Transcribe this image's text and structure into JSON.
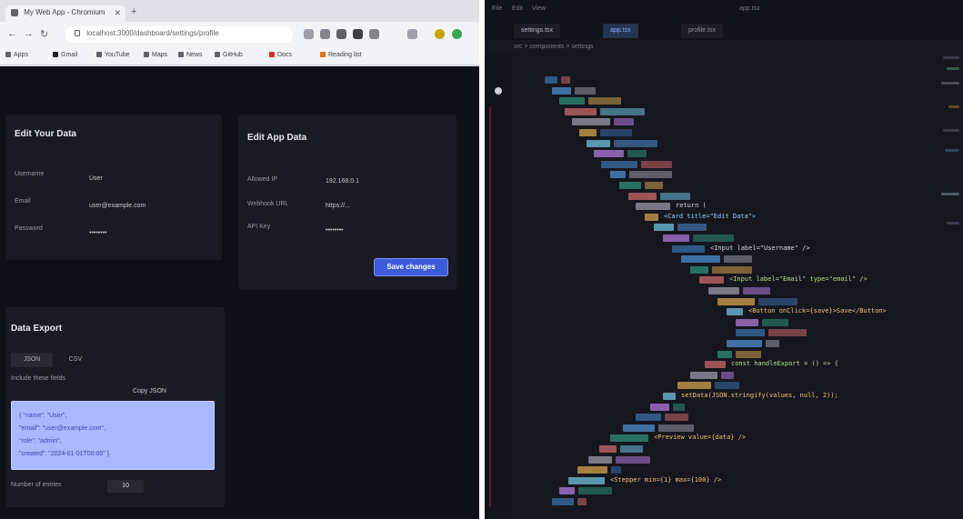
{
  "browser": {
    "tab_title": "My Web App - Chromium",
    "address": "localhost:3000/dashboard/settings/profile",
    "bookmarks": [
      "Apps",
      "Gmail",
      "YouTube",
      "Maps",
      "News",
      "GitHub",
      "Docs",
      "Reading list"
    ]
  },
  "page": {
    "edit_profile_card": {
      "title": "Edit Your Data",
      "rows": [
        {
          "label": "Username",
          "value": "User"
        },
        {
          "label": "Email",
          "value": "user@example.com"
        },
        {
          "label": "Password",
          "value": "••••••••"
        }
      ]
    },
    "edit_app_card": {
      "title": "Edit App Data",
      "rows": [
        {
          "label": "Allowed IP",
          "value": "192.168.0.1"
        },
        {
          "label": "Webhook URL",
          "value": "https://..."
        },
        {
          "label": "API Key",
          "value": "••••••••"
        }
      ],
      "save_label": "Save changes"
    },
    "export_card": {
      "title": "Data Export",
      "segments": [
        "JSON",
        "CSV"
      ],
      "caption": "Include these fields",
      "side_button": "Copy JSON",
      "preview_lines": [
        "{ \"name\": \"User\",",
        "  \"email\": \"user@example.com\",",
        "  \"role\": \"admin\",",
        "  \"created\": \"2024-01-01T00:00\" }"
      ],
      "stepper_label": "Number of entries",
      "stepper_value": "10"
    }
  },
  "editor": {
    "title_items": [
      "File",
      "Edit",
      "View"
    ],
    "window_title": "app.tsx",
    "tabs": [
      "settings.tsx",
      "app.tsx",
      "profile.tsx"
    ],
    "breadcrumb": "src > components > settings",
    "code_snippets": [
      "return (",
      "<Card title=\"Edit Data\">",
      "<Input label=\"Username\" />",
      "<Input label=\"Email\" type=\"email\" />",
      "<Button onClick={save}>Save</Button>",
      "const handleExport = () => {",
      "setData(JSON.stringify(values, null, 2));",
      "<Preview value={data} />",
      "<Stepper min={1} max={100} />"
    ]
  }
}
